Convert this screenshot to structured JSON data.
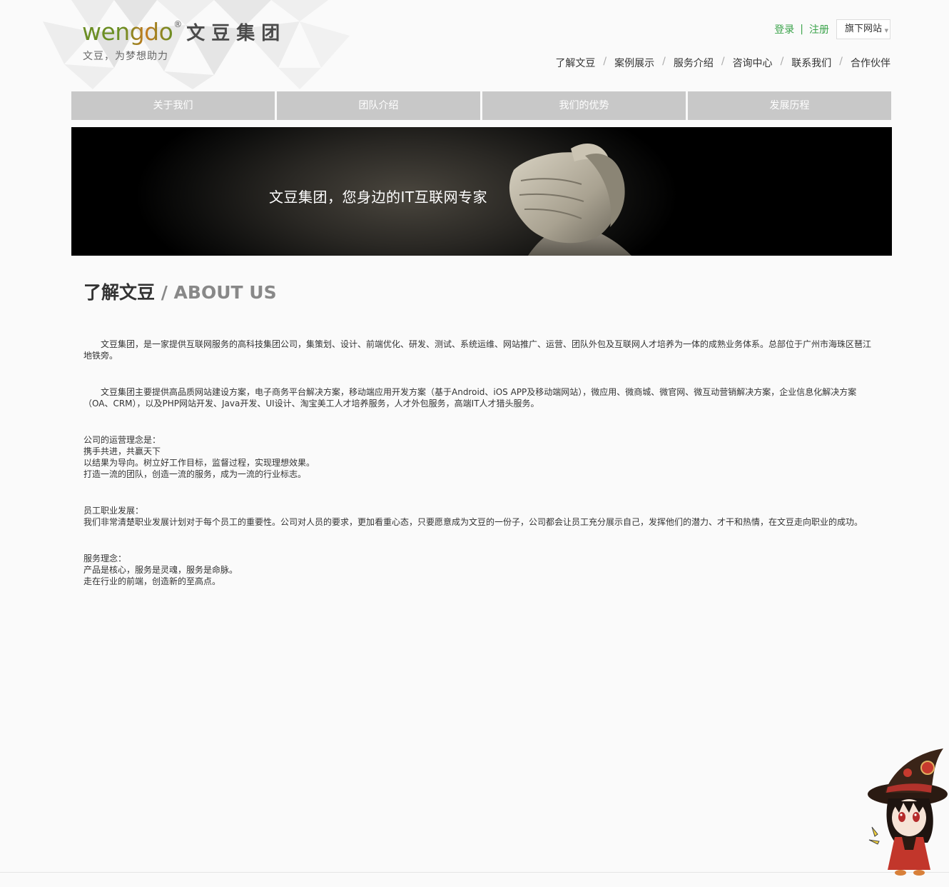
{
  "header": {
    "logo_text": "wengdo",
    "logo_reg": "®",
    "logo_cn": "文豆集团",
    "slogan": "文豆，为梦想助力",
    "login": "登录",
    "auth_sep": "|",
    "register": "注册",
    "sites": "旗下网站"
  },
  "nav": {
    "items": [
      "了解文豆",
      "案例展示",
      "服务介绍",
      "咨询中心",
      "联系我们",
      "合作伙伴"
    ],
    "separator": "/"
  },
  "subnav": {
    "tabs": [
      "关于我们",
      "团队介绍",
      "我们的优势",
      "发展历程"
    ]
  },
  "banner": {
    "text": "文豆集团，您身边的IT互联网专家"
  },
  "section": {
    "title_cn": "了解文豆",
    "title_en": " / ABOUT US"
  },
  "content": {
    "p1": "文豆集团，是一家提供互联网服务的高科技集团公司，集策划、设计、前端优化、研发、测试、系统运维、网站推广、运营、团队外包及互联网人才培养为一体的成熟业务体系。总部位于广州市海珠区琶江地铁旁。",
    "p2": "文豆集团主要提供高品质网站建设方案，电子商务平台解决方案，移动端应用开发方案（基于Android、iOS APP及移动端网站），微应用、微商城、微官网、微互动营销解决方案，企业信息化解决方案（OA、CRM），以及PHP网站开发、Java开发、UI设计、淘宝美工人才培养服务，人才外包服务，高端IT人才猎头服务。",
    "p3": [
      "公司的运营理念是：",
      "携手共进，共赢天下",
      "以结果为导向。树立好工作目标，监督过程，实现理想效果。",
      "打造一流的团队，创造一流的服务，成为一流的行业标志。"
    ],
    "p4": [
      "员工职业发展：",
      "我们非常清楚职业发展计划对于每个员工的重要性。公司对人员的要求，更加看重心态，只要愿意成为文豆的一份子，公司都会让员工充分展示自己，发挥他们的潜力、才干和热情，在文豆走向职业的成功。"
    ],
    "p5": [
      "服务理念：",
      "产品是核心，服务是灵魂，服务是命脉。",
      "走在行业的前端，创造新的至高点。"
    ]
  },
  "colors": {
    "brand_green": "#6b8e23",
    "brand_orange": "#c47a1f",
    "link_green": "#3aa34a",
    "tab_gray": "#c8c8c8"
  }
}
